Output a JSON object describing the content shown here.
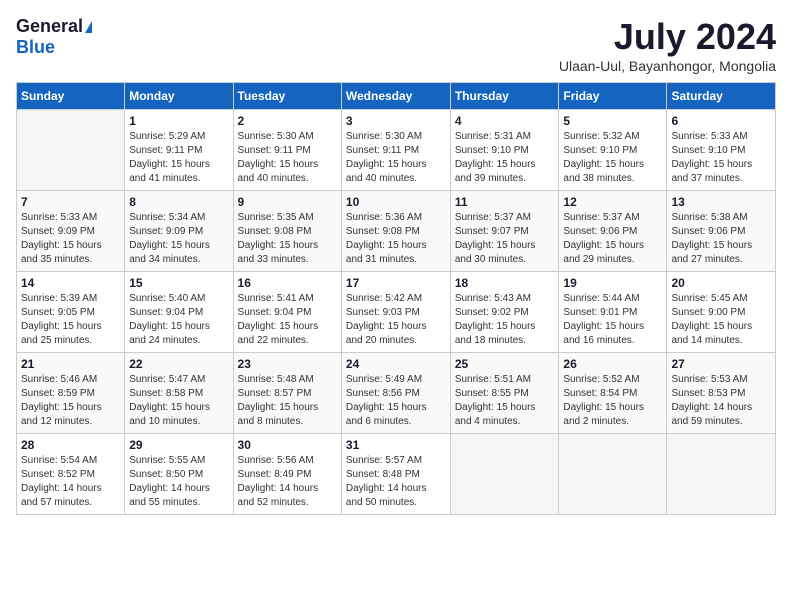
{
  "header": {
    "logo_general": "General",
    "logo_blue": "Blue",
    "month_title": "July 2024",
    "subtitle": "Ulaan-Uul, Bayanhongor, Mongolia"
  },
  "calendar": {
    "days_of_week": [
      "Sunday",
      "Monday",
      "Tuesday",
      "Wednesday",
      "Thursday",
      "Friday",
      "Saturday"
    ],
    "weeks": [
      [
        {
          "day": "",
          "info": ""
        },
        {
          "day": "1",
          "info": "Sunrise: 5:29 AM\nSunset: 9:11 PM\nDaylight: 15 hours\nand 41 minutes."
        },
        {
          "day": "2",
          "info": "Sunrise: 5:30 AM\nSunset: 9:11 PM\nDaylight: 15 hours\nand 40 minutes."
        },
        {
          "day": "3",
          "info": "Sunrise: 5:30 AM\nSunset: 9:11 PM\nDaylight: 15 hours\nand 40 minutes."
        },
        {
          "day": "4",
          "info": "Sunrise: 5:31 AM\nSunset: 9:10 PM\nDaylight: 15 hours\nand 39 minutes."
        },
        {
          "day": "5",
          "info": "Sunrise: 5:32 AM\nSunset: 9:10 PM\nDaylight: 15 hours\nand 38 minutes."
        },
        {
          "day": "6",
          "info": "Sunrise: 5:33 AM\nSunset: 9:10 PM\nDaylight: 15 hours\nand 37 minutes."
        }
      ],
      [
        {
          "day": "7",
          "info": "Sunrise: 5:33 AM\nSunset: 9:09 PM\nDaylight: 15 hours\nand 35 minutes."
        },
        {
          "day": "8",
          "info": "Sunrise: 5:34 AM\nSunset: 9:09 PM\nDaylight: 15 hours\nand 34 minutes."
        },
        {
          "day": "9",
          "info": "Sunrise: 5:35 AM\nSunset: 9:08 PM\nDaylight: 15 hours\nand 33 minutes."
        },
        {
          "day": "10",
          "info": "Sunrise: 5:36 AM\nSunset: 9:08 PM\nDaylight: 15 hours\nand 31 minutes."
        },
        {
          "day": "11",
          "info": "Sunrise: 5:37 AM\nSunset: 9:07 PM\nDaylight: 15 hours\nand 30 minutes."
        },
        {
          "day": "12",
          "info": "Sunrise: 5:37 AM\nSunset: 9:06 PM\nDaylight: 15 hours\nand 29 minutes."
        },
        {
          "day": "13",
          "info": "Sunrise: 5:38 AM\nSunset: 9:06 PM\nDaylight: 15 hours\nand 27 minutes."
        }
      ],
      [
        {
          "day": "14",
          "info": "Sunrise: 5:39 AM\nSunset: 9:05 PM\nDaylight: 15 hours\nand 25 minutes."
        },
        {
          "day": "15",
          "info": "Sunrise: 5:40 AM\nSunset: 9:04 PM\nDaylight: 15 hours\nand 24 minutes."
        },
        {
          "day": "16",
          "info": "Sunrise: 5:41 AM\nSunset: 9:04 PM\nDaylight: 15 hours\nand 22 minutes."
        },
        {
          "day": "17",
          "info": "Sunrise: 5:42 AM\nSunset: 9:03 PM\nDaylight: 15 hours\nand 20 minutes."
        },
        {
          "day": "18",
          "info": "Sunrise: 5:43 AM\nSunset: 9:02 PM\nDaylight: 15 hours\nand 18 minutes."
        },
        {
          "day": "19",
          "info": "Sunrise: 5:44 AM\nSunset: 9:01 PM\nDaylight: 15 hours\nand 16 minutes."
        },
        {
          "day": "20",
          "info": "Sunrise: 5:45 AM\nSunset: 9:00 PM\nDaylight: 15 hours\nand 14 minutes."
        }
      ],
      [
        {
          "day": "21",
          "info": "Sunrise: 5:46 AM\nSunset: 8:59 PM\nDaylight: 15 hours\nand 12 minutes."
        },
        {
          "day": "22",
          "info": "Sunrise: 5:47 AM\nSunset: 8:58 PM\nDaylight: 15 hours\nand 10 minutes."
        },
        {
          "day": "23",
          "info": "Sunrise: 5:48 AM\nSunset: 8:57 PM\nDaylight: 15 hours\nand 8 minutes."
        },
        {
          "day": "24",
          "info": "Sunrise: 5:49 AM\nSunset: 8:56 PM\nDaylight: 15 hours\nand 6 minutes."
        },
        {
          "day": "25",
          "info": "Sunrise: 5:51 AM\nSunset: 8:55 PM\nDaylight: 15 hours\nand 4 minutes."
        },
        {
          "day": "26",
          "info": "Sunrise: 5:52 AM\nSunset: 8:54 PM\nDaylight: 15 hours\nand 2 minutes."
        },
        {
          "day": "27",
          "info": "Sunrise: 5:53 AM\nSunset: 8:53 PM\nDaylight: 14 hours\nand 59 minutes."
        }
      ],
      [
        {
          "day": "28",
          "info": "Sunrise: 5:54 AM\nSunset: 8:52 PM\nDaylight: 14 hours\nand 57 minutes."
        },
        {
          "day": "29",
          "info": "Sunrise: 5:55 AM\nSunset: 8:50 PM\nDaylight: 14 hours\nand 55 minutes."
        },
        {
          "day": "30",
          "info": "Sunrise: 5:56 AM\nSunset: 8:49 PM\nDaylight: 14 hours\nand 52 minutes."
        },
        {
          "day": "31",
          "info": "Sunrise: 5:57 AM\nSunset: 8:48 PM\nDaylight: 14 hours\nand 50 minutes."
        },
        {
          "day": "",
          "info": ""
        },
        {
          "day": "",
          "info": ""
        },
        {
          "day": "",
          "info": ""
        }
      ]
    ]
  }
}
